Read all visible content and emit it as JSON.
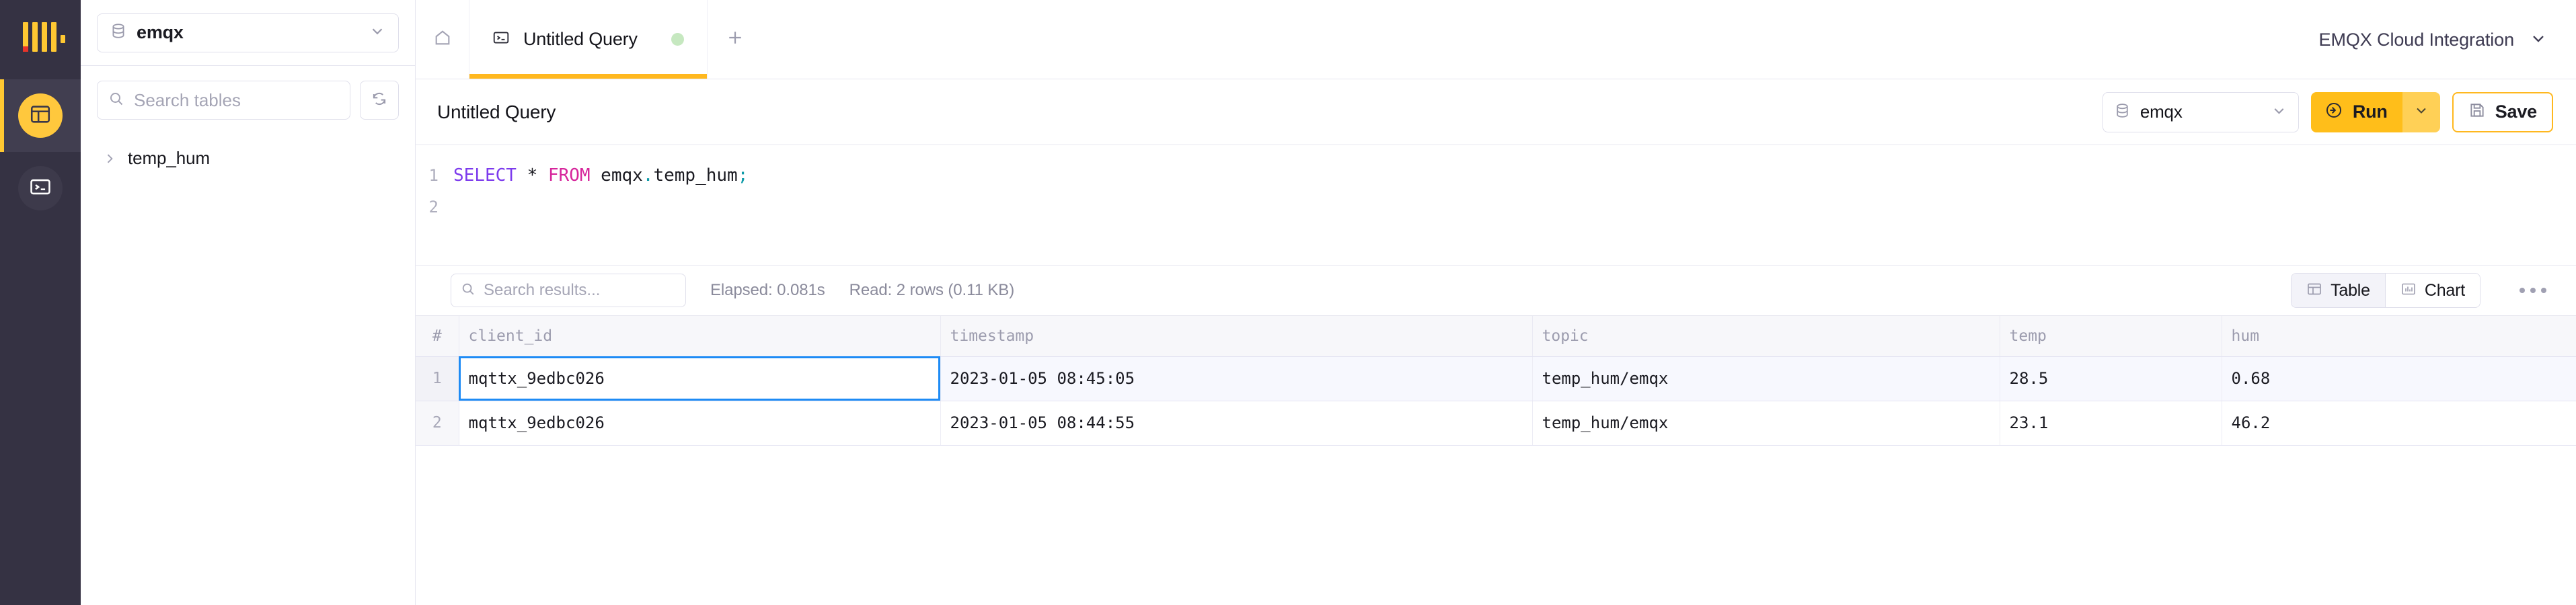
{
  "rail": {
    "logo_name": "clickhouse-logo",
    "items": [
      {
        "name": "sidebar-item-tables",
        "icon": "table-layout-icon",
        "active": true
      },
      {
        "name": "sidebar-item-console",
        "icon": "terminal-icon",
        "active": false
      }
    ]
  },
  "left_panel": {
    "database_selector": {
      "label": "emqx",
      "icon": "database-icon",
      "caret": "chevron-down-icon"
    },
    "search": {
      "placeholder": "Search tables",
      "value": "",
      "icon": "search-icon"
    },
    "refresh": {
      "icon": "refresh-icon"
    },
    "tree": [
      {
        "label": "temp_hum",
        "caret": "chevron-right-icon",
        "expanded": false
      }
    ]
  },
  "tabbar": {
    "home": {
      "icon": "home-icon"
    },
    "tabs": [
      {
        "label": "Untitled Query",
        "icon": "terminal-icon",
        "status_dot": "#C6E8C0",
        "active": true
      }
    ],
    "add": {
      "icon": "plus-icon"
    },
    "workspace": {
      "label": "EMQX Cloud Integration",
      "caret": "chevron-down-icon"
    }
  },
  "query_toolbar": {
    "title": "Untitled Query",
    "database": {
      "label": "emqx",
      "icon": "database-icon",
      "caret": "chevron-down-icon"
    },
    "run": {
      "label": "Run",
      "icon": "play-circle-icon",
      "caret": "chevron-down-icon"
    },
    "save": {
      "label": "Save",
      "icon": "save-icon"
    }
  },
  "editor": {
    "lines": [
      {
        "number": "1",
        "tokens": [
          {
            "text": "SELECT",
            "cls": "tok-kw"
          },
          {
            "text": " ",
            "cls": ""
          },
          {
            "text": "*",
            "cls": "tok-star"
          },
          {
            "text": " ",
            "cls": ""
          },
          {
            "text": "FROM",
            "cls": "tok-kw2"
          },
          {
            "text": " emqx",
            "cls": ""
          },
          {
            "text": ".",
            "cls": "tok-punc"
          },
          {
            "text": "temp_hum",
            "cls": ""
          },
          {
            "text": ";",
            "cls": "tok-punc"
          }
        ]
      },
      {
        "number": "2",
        "tokens": []
      }
    ],
    "plain_text": "SELECT * FROM emqx.temp_hum;"
  },
  "results_toolbar": {
    "search": {
      "placeholder": "Search results...",
      "value": "",
      "icon": "search-icon"
    },
    "elapsed": "Elapsed: 0.081s",
    "read": "Read: 2 rows (0.11 KB)",
    "views": [
      {
        "label": "Table",
        "icon": "table-icon",
        "active": true
      },
      {
        "label": "Chart",
        "icon": "bar-chart-icon",
        "active": false
      }
    ],
    "more": {
      "icon": "ellipsis-icon"
    }
  },
  "results_table": {
    "columns": [
      "#",
      "client_id",
      "timestamp",
      "topic",
      "temp",
      "hum"
    ],
    "rows": [
      {
        "num": "1",
        "client_id": "mqttx_9edbc026",
        "timestamp": "2023-01-05 08:45:05",
        "topic": "temp_hum/emqx",
        "temp": "28.5",
        "hum": "0.68",
        "selected": true,
        "focus_cell": "client_id"
      },
      {
        "num": "2",
        "client_id": "mqttx_9edbc026",
        "timestamp": "2023-01-05 08:44:55",
        "topic": "temp_hum/emqx",
        "temp": "23.1",
        "hum": "46.2",
        "selected": false,
        "focus_cell": ""
      }
    ]
  },
  "colors": {
    "accent": "#FFBE1A",
    "rail_bg": "#353243",
    "rail_active": "#413E50",
    "selection_blue": "#1E8BF5",
    "tab_underline": "#FFB81F",
    "status_green": "#C6E8C0"
  }
}
